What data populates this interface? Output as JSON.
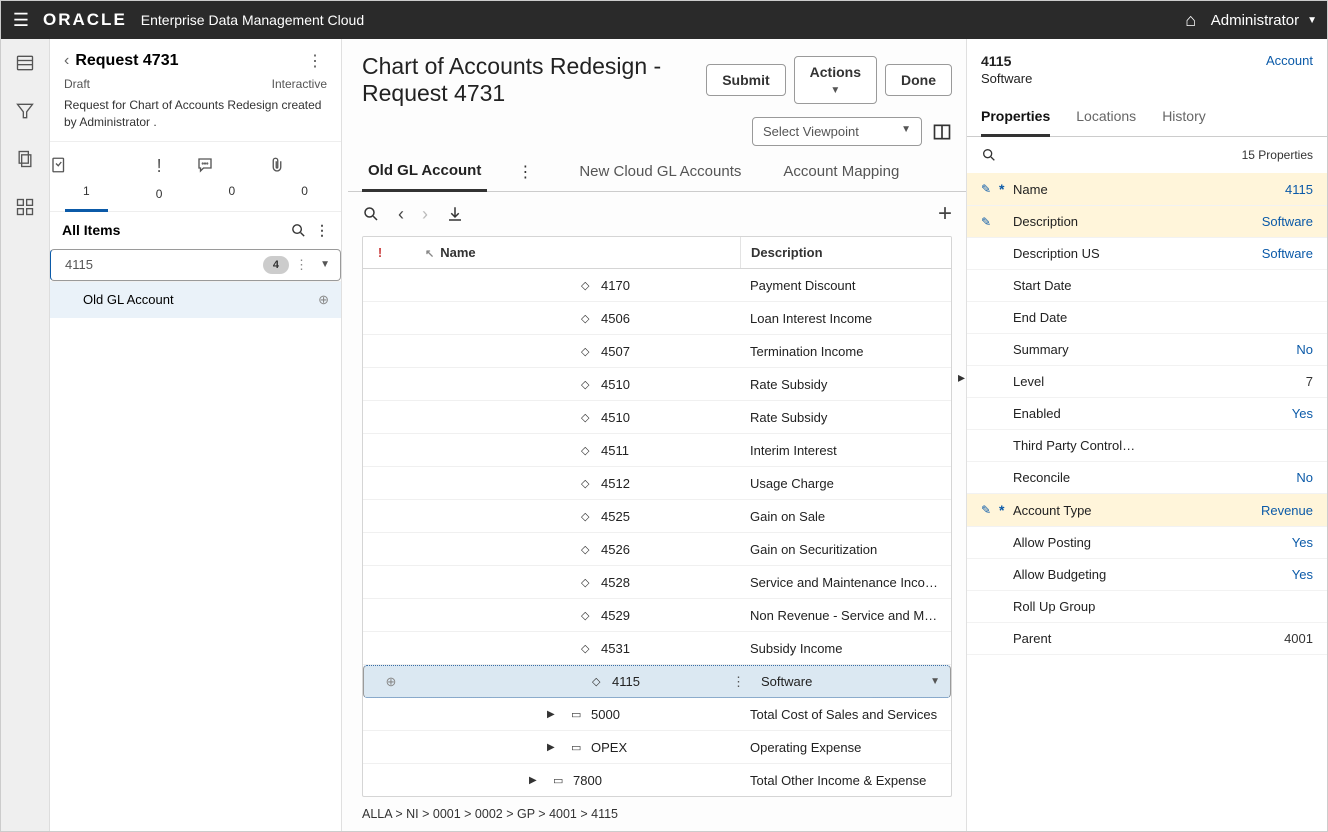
{
  "header": {
    "brand": "ORACLE",
    "product": "Enterprise Data Management Cloud",
    "user": "Administrator"
  },
  "request": {
    "title": "Request 4731",
    "status": "Draft",
    "mode": "Interactive",
    "description": "Request for Chart of Accounts Redesign created by Administrator ."
  },
  "tabIcons": [
    {
      "count": "1"
    },
    {
      "count": "0"
    },
    {
      "count": "0"
    },
    {
      "count": "0"
    }
  ],
  "sections": {
    "allItems": {
      "label": "All Items"
    }
  },
  "items": [
    {
      "name": "4115",
      "badge": "4",
      "selected": true
    },
    {
      "name": "Old GL Account",
      "sub": true
    }
  ],
  "page": {
    "titleA": "Chart of Accounts Redesign -",
    "titleB": "Request 4731",
    "submit": "Submit",
    "actions": "Actions",
    "done": "Done",
    "viewpoint": "Select Viewpoint"
  },
  "tabs": [
    {
      "label": "Old GL Account",
      "active": true
    },
    {
      "label": "New Cloud GL Accounts"
    },
    {
      "label": "Account Mapping"
    }
  ],
  "gridHead": {
    "flag": "!",
    "sort": "↖",
    "name": "Name",
    "desc": "Description"
  },
  "rows": [
    {
      "indent": 184,
      "icon": "leaf",
      "name": "4170",
      "desc": "Payment Discount"
    },
    {
      "indent": 184,
      "icon": "leaf",
      "name": "4506",
      "desc": "Loan Interest Income"
    },
    {
      "indent": 184,
      "icon": "leaf",
      "name": "4507",
      "desc": "Termination Income"
    },
    {
      "indent": 184,
      "icon": "leaf",
      "name": "4510",
      "desc": "Rate Subsidy"
    },
    {
      "indent": 184,
      "icon": "leaf",
      "name": "4510",
      "desc": "Rate Subsidy"
    },
    {
      "indent": 184,
      "icon": "leaf",
      "name": "4511",
      "desc": "Interim Interest"
    },
    {
      "indent": 184,
      "icon": "leaf",
      "name": "4512",
      "desc": "Usage Charge"
    },
    {
      "indent": 184,
      "icon": "leaf",
      "name": "4525",
      "desc": "Gain on Sale"
    },
    {
      "indent": 184,
      "icon": "leaf",
      "name": "4526",
      "desc": "Gain on Securitization"
    },
    {
      "indent": 184,
      "icon": "leaf",
      "name": "4528",
      "desc": "Service and Maintenance Income"
    },
    {
      "indent": 184,
      "icon": "leaf",
      "name": "4529",
      "desc": "Non Revenue - Service and Ma..."
    },
    {
      "indent": 184,
      "icon": "leaf",
      "name": "4531",
      "desc": "Subsidy Income"
    },
    {
      "indent": 184,
      "icon": "leaf",
      "name": "4115",
      "desc": "Software",
      "selected": true,
      "add": true
    },
    {
      "indent": 150,
      "icon": "fold-exp",
      "name": "5000",
      "desc": "Total Cost of Sales and Services"
    },
    {
      "indent": 150,
      "icon": "fold-exp",
      "name": "OPEX",
      "desc": "Operating Expense"
    },
    {
      "indent": 132,
      "icon": "fold-exp",
      "name": "7800",
      "desc": "Total Other Income & Expense"
    }
  ],
  "breadcrumb": "ALLA > NI > 0001 > 0002 > GP > 4001 > 4115",
  "detail": {
    "code": "4115",
    "name": "Software",
    "typeLink": "Account"
  },
  "detailTabs": [
    {
      "label": "Properties",
      "active": true
    },
    {
      "label": "Locations"
    },
    {
      "label": "History"
    }
  ],
  "propsCount": "15 Properties",
  "props": [
    {
      "ed": true,
      "rq": true,
      "label": "Name",
      "value": "4115",
      "hl": true,
      "link": true
    },
    {
      "ed": true,
      "label": "Description",
      "value": "Software",
      "hl": true,
      "link": true
    },
    {
      "label": "Description US",
      "value": "Software",
      "link": true
    },
    {
      "label": "Start Date",
      "value": ""
    },
    {
      "label": "End Date",
      "value": ""
    },
    {
      "label": "Summary",
      "value": "No",
      "link": true
    },
    {
      "label": "Level",
      "value": "7"
    },
    {
      "label": "Enabled",
      "value": "Yes",
      "link": true
    },
    {
      "label": "Third Party Control…",
      "value": ""
    },
    {
      "label": "Reconcile",
      "value": "No",
      "link": true
    },
    {
      "ed": true,
      "rq": true,
      "label": "Account Type",
      "value": "Revenue",
      "hl": true,
      "link": true
    },
    {
      "label": "Allow Posting",
      "value": "Yes",
      "link": true
    },
    {
      "label": "Allow Budgeting",
      "value": "Yes",
      "link": true
    },
    {
      "label": "Roll Up Group",
      "value": ""
    },
    {
      "label": "Parent",
      "value": "4001"
    }
  ]
}
